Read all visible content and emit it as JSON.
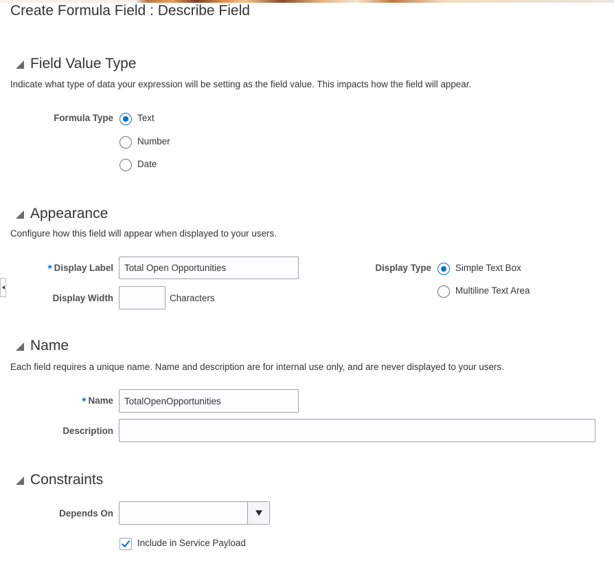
{
  "page": {
    "title": "Create Formula Field : Describe Field"
  },
  "field_value_type": {
    "title": "Field Value Type",
    "instruction": "Indicate what type of data your expression will be setting as the field value. This impacts how the field will appear.",
    "formula_type_label": "Formula Type",
    "options": [
      {
        "label": "Text",
        "selected": true
      },
      {
        "label": "Number",
        "selected": false
      },
      {
        "label": "Date",
        "selected": false
      }
    ]
  },
  "appearance": {
    "title": "Appearance",
    "instruction": "Configure how this field will appear when displayed to your users.",
    "required_marker": "*",
    "display_label": {
      "label": "Display Label",
      "value": "Total Open Opportunities"
    },
    "display_width": {
      "label": "Display Width",
      "value": "",
      "suffix": "Characters"
    },
    "display_type": {
      "label": "Display Type",
      "options": [
        {
          "label": "Simple Text Box",
          "selected": true
        },
        {
          "label": "Multiline Text Area",
          "selected": false
        }
      ]
    }
  },
  "name_section": {
    "title": "Name",
    "instruction": "Each field requires a unique name. Name and description are for internal use only, and are never displayed to your users.",
    "required_marker": "*",
    "name": {
      "label": "Name",
      "value": "TotalOpenOpportunities"
    },
    "description": {
      "label": "Description",
      "value": ""
    }
  },
  "constraints": {
    "title": "Constraints",
    "depends_on": {
      "label": "Depends On",
      "value": ""
    },
    "include_payload": {
      "label": "Include in Service Payload",
      "checked": true
    }
  },
  "colors": {
    "accent": "#0572ce",
    "text": "#333333",
    "label": "#4f4f4f",
    "border": "#9ea4a8"
  },
  "icons": {
    "section_toggle": "collapse-triangle-icon",
    "dropdown": "caret-down-icon",
    "check": "checkmark-icon",
    "splitter": "arrow-left-icon"
  }
}
